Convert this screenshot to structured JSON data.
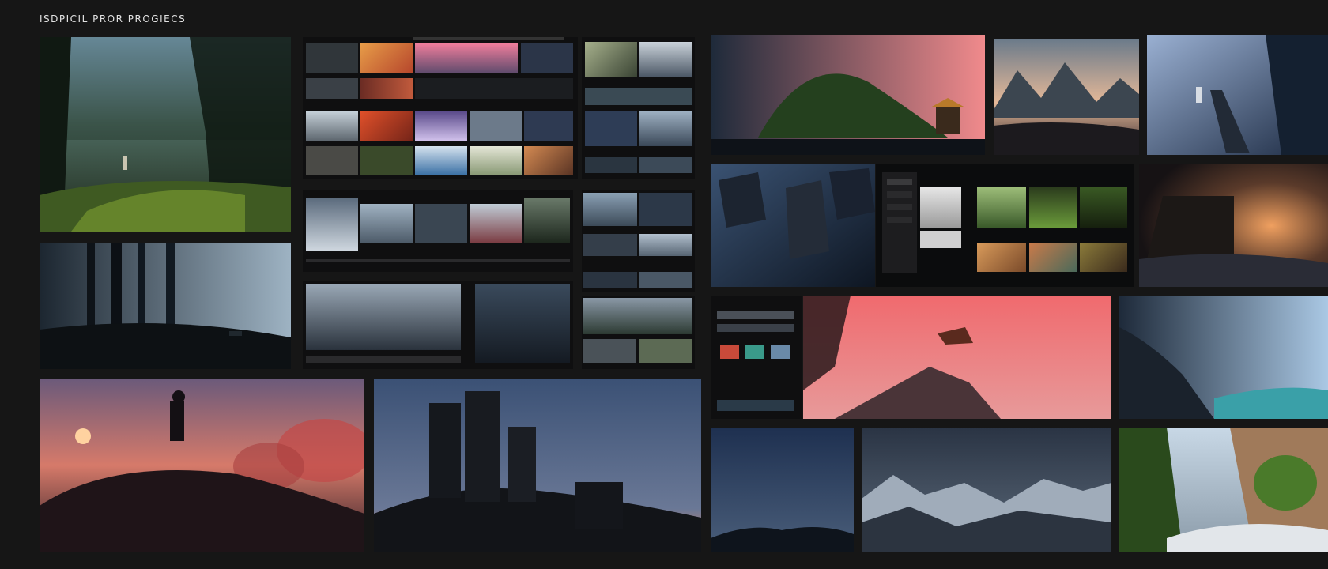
{
  "page": {
    "title": "ISDPICIL PROR PROGIECS"
  },
  "tiles": {
    "forest_path": {
      "icon": "image-icon"
    },
    "dark_forest": {
      "icon": "image-icon"
    },
    "cliff_sunset": {
      "icon": "image-icon"
    },
    "silhouette_group": {
      "icon": "image-icon"
    },
    "island_birds": {
      "icon": "image-icon"
    },
    "mountain_lake": {
      "icon": "image-icon"
    },
    "snow_stairs": {
      "icon": "image-icon"
    },
    "space_rocks": {
      "icon": "image-icon"
    },
    "cabin_glow": {
      "icon": "image-icon"
    },
    "pink_peak": {
      "icon": "image-icon"
    },
    "blue_cave": {
      "icon": "image-icon"
    },
    "night_hills": {
      "icon": "image-icon"
    },
    "snow_range": {
      "icon": "image-icon"
    },
    "cliff_trees": {
      "icon": "image-icon"
    }
  },
  "colors": {
    "background": "#161616",
    "panel": "#0f0f10",
    "accent_pink": "#f07a7c",
    "accent_blue": "#2d4f7a"
  }
}
